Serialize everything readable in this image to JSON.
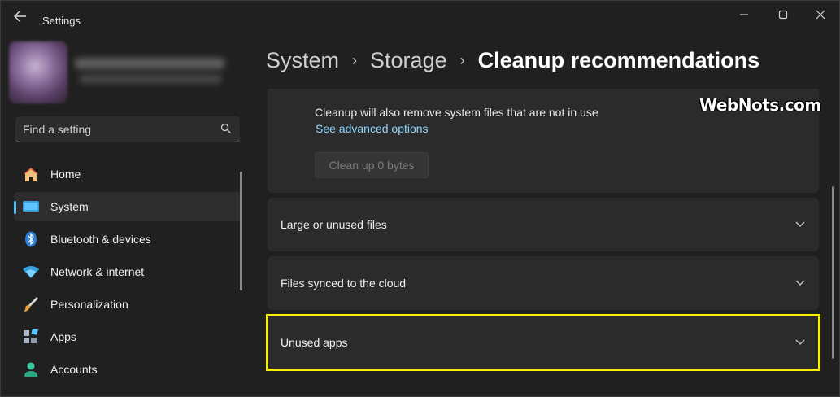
{
  "titlebar": {
    "title": "Settings",
    "back_icon": "back-arrow-icon",
    "controls": [
      "minimize-icon",
      "maximize-icon",
      "close-icon"
    ]
  },
  "search": {
    "placeholder": "Find a setting",
    "icon": "search-icon"
  },
  "sidebar": {
    "items": [
      {
        "label": "Home",
        "icon": "home-icon",
        "active": false
      },
      {
        "label": "System",
        "icon": "system-display-icon",
        "active": true
      },
      {
        "label": "Bluetooth & devices",
        "icon": "bluetooth-icon",
        "active": false
      },
      {
        "label": "Network & internet",
        "icon": "wifi-icon",
        "active": false
      },
      {
        "label": "Personalization",
        "icon": "paintbrush-icon",
        "active": false
      },
      {
        "label": "Apps",
        "icon": "apps-icon",
        "active": false
      },
      {
        "label": "Accounts",
        "icon": "person-icon",
        "active": false
      }
    ]
  },
  "breadcrumb": {
    "items": [
      "System",
      "Storage"
    ],
    "current": "Cleanup recommendations",
    "separator": "›"
  },
  "cleanup": {
    "note": "Cleanup will also remove system files that are not in use",
    "link": "See advanced options",
    "button": "Clean up 0 bytes"
  },
  "sections": [
    {
      "label": "Large or unused files",
      "expanded": false
    },
    {
      "label": "Files synced to the cloud",
      "expanded": false
    },
    {
      "label": "Unused apps",
      "expanded": false,
      "highlighted": true
    }
  ],
  "watermark": "WebNots.com",
  "colors": {
    "accent": "#4cc2ff",
    "link": "#8fd5ff",
    "highlight_border": "#f5f200",
    "card_bg": "#2b2b2b",
    "window_bg": "#202020"
  }
}
